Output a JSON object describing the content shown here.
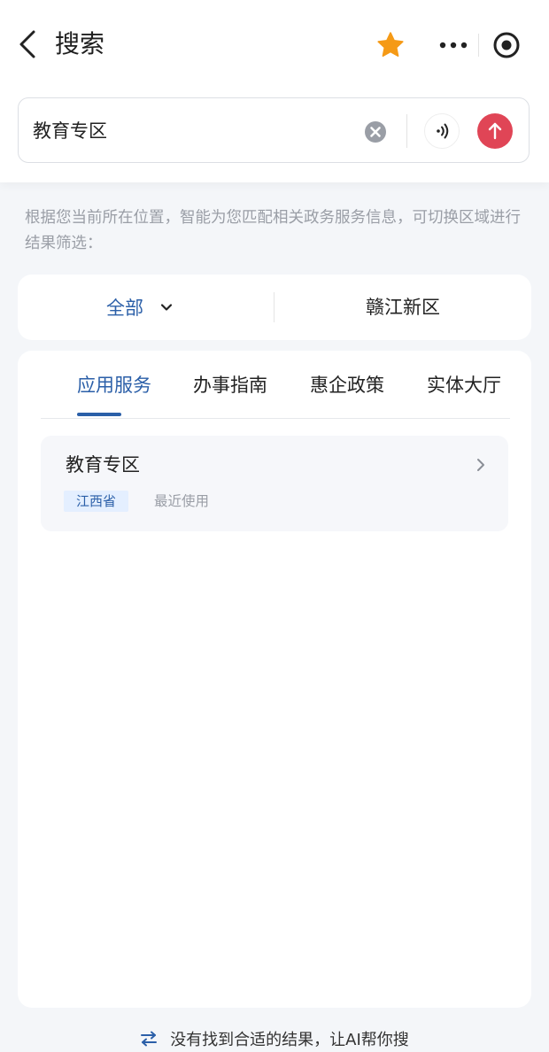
{
  "nav": {
    "title": "搜索",
    "icons": [
      "back-icon",
      "star-icon",
      "more-icon",
      "target-icon"
    ],
    "star_color": "#f59a16"
  },
  "search": {
    "value": "教育专区",
    "icons": [
      "clear-icon",
      "voice-icon",
      "submit-icon"
    ],
    "submit_color": "#e04556"
  },
  "hint": "根据您当前所在位置，智能为您匹配相关政务服务信息，可切换区域进行结果筛选：",
  "filter": {
    "all_label": "全部",
    "region_label": "赣江新区"
  },
  "tabs": [
    {
      "label": "应用服务",
      "active": true
    },
    {
      "label": "办事指南",
      "active": false
    },
    {
      "label": "惠企政策",
      "active": false
    },
    {
      "label": "实体大厅",
      "active": false
    }
  ],
  "results": [
    {
      "title": "教育专区",
      "tag": "江西省",
      "meta": "最近使用"
    }
  ],
  "bottom_hint": "没有找到合适的结果，让AI帮你搜",
  "colors": {
    "accent": "#2b5fa8",
    "tag_bg": "#e4efff",
    "page_bg": "#f4f6f9"
  }
}
